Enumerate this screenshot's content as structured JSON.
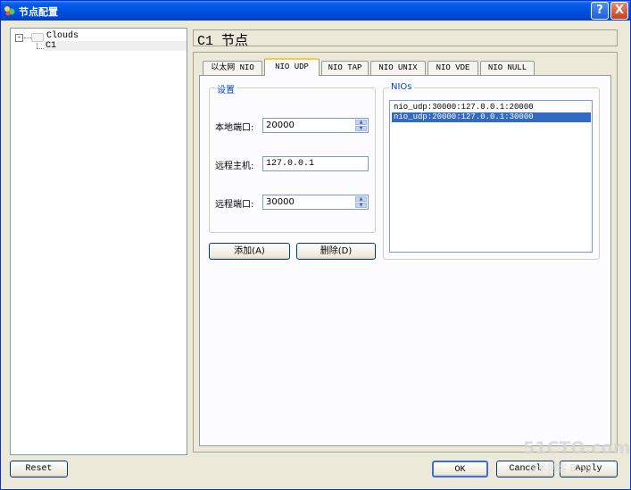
{
  "window": {
    "title": "节点配置",
    "help_label": "?",
    "close_label": "X"
  },
  "tree": {
    "expander": "-",
    "root_label": "Clouds",
    "child_label": "C1"
  },
  "header": {
    "title": "C1 节点"
  },
  "tabs": [
    {
      "label": "以太网 NIO",
      "active": false
    },
    {
      "label": "NIO UDP",
      "active": true
    },
    {
      "label": "NIO TAP",
      "active": false
    },
    {
      "label": "NIO UNIX",
      "active": false
    },
    {
      "label": "NIO VDE",
      "active": false
    },
    {
      "label": "NIO NULL",
      "active": false
    }
  ],
  "settings_group": {
    "title": "设置",
    "local_port_label": "本地端口:",
    "local_port_value": "20000",
    "remote_host_label": "远程主机:",
    "remote_host_value": "127.0.0.1",
    "remote_port_label": "远程端口:",
    "remote_port_value": "30000"
  },
  "actions": {
    "add_label": "添加(A)",
    "delete_label": "删除(D)"
  },
  "nios_group": {
    "title": "NIOs",
    "items": [
      {
        "text": "nio_udp:30000:127.0.0.1:20000",
        "selected": false
      },
      {
        "text": "nio_udp:20000:127.0.0.1:30000",
        "selected": true
      }
    ]
  },
  "footer": {
    "reset_label": "Reset",
    "ok_label": "OK",
    "cancel_label": "Cancel",
    "apply_label": "Apply"
  },
  "watermark": {
    "main": "51CTO.com",
    "sub": "技术博客 Blog"
  },
  "colors": {
    "titlebar": "#0054e3",
    "selection": "#316ac5",
    "group_title": "#0046d5",
    "active_tab_accent": "#ffc83c"
  }
}
